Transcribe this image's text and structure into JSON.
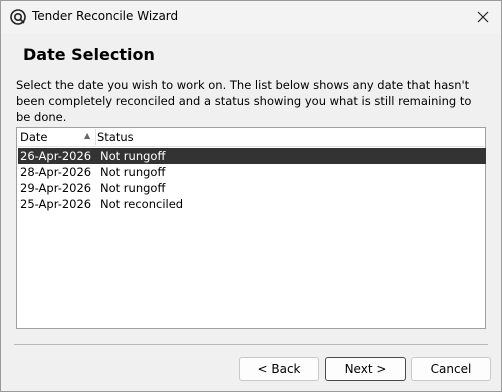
{
  "window": {
    "title": "Tender Reconcile Wizard"
  },
  "icons": {
    "app": "app-logo-icon",
    "close": "close-icon",
    "sort": "sort-ascending-icon"
  },
  "header": {
    "title": "Date Selection"
  },
  "description": "Select the date you wish to work on. The list below shows any date that hasn't been completely reconciled and a status showing you what is still remaining to be done.",
  "list": {
    "columns": [
      "Date",
      "Status"
    ],
    "rows": [
      {
        "date": "26-Apr-2026",
        "status": "Not rungoff",
        "selected": true
      },
      {
        "date": "28-Apr-2026",
        "status": "Not rungoff",
        "selected": false
      },
      {
        "date": "29-Apr-2026",
        "status": "Not rungoff",
        "selected": false
      },
      {
        "date": "25-Apr-2026",
        "status": "Not reconciled",
        "selected": false
      }
    ]
  },
  "buttons": {
    "back": "< Back",
    "next": "Next >",
    "cancel": "Cancel"
  }
}
